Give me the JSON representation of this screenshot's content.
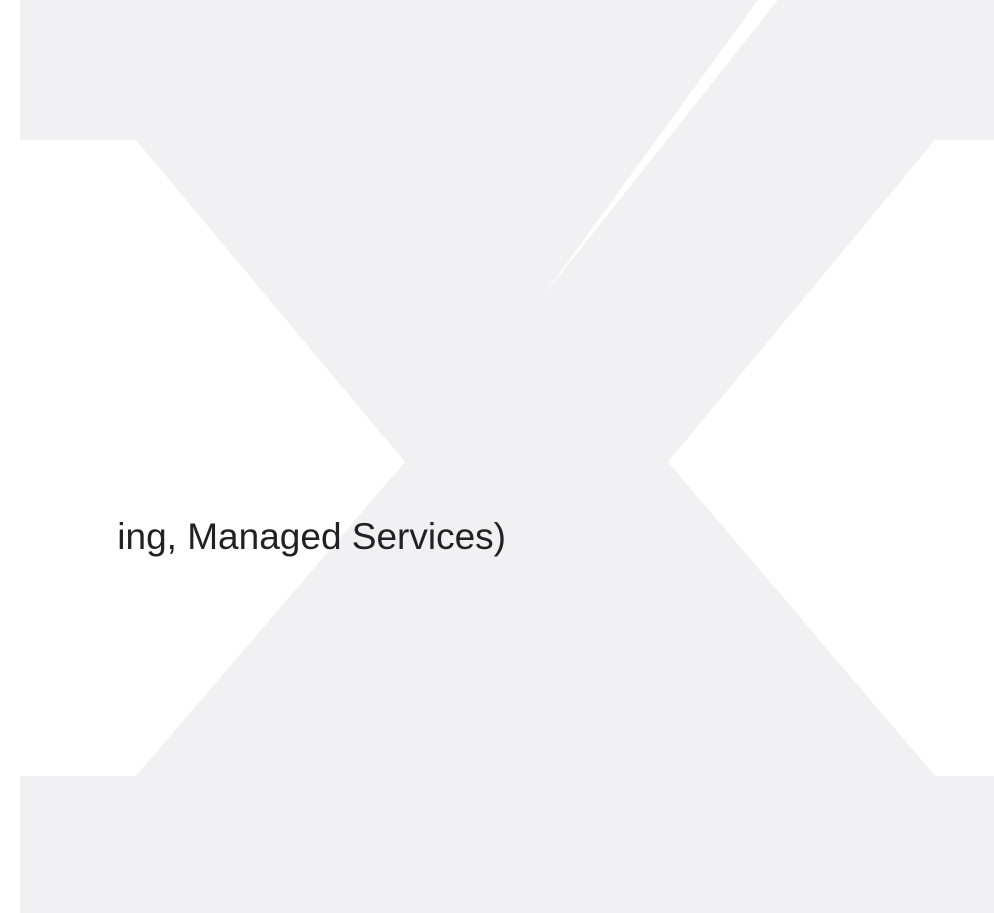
{
  "caption": {
    "text": "ing, Managed Services)"
  },
  "colors": {
    "background": "#ffffff",
    "watermark": "#f1f1f3",
    "text": "#222222"
  },
  "watermark": {
    "icon": "x-logo-watermark"
  }
}
